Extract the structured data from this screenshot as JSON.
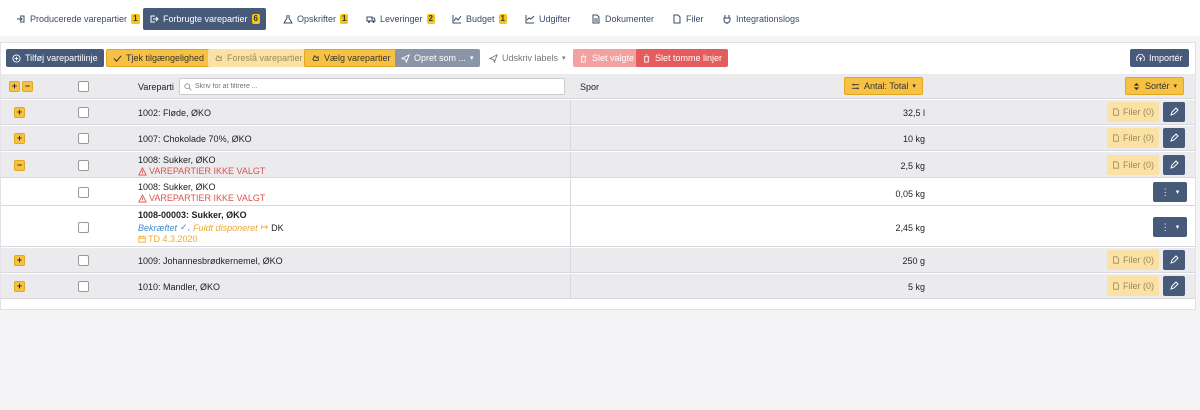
{
  "tabs": [
    {
      "label": "Producerede varepartier",
      "badge": "1"
    },
    {
      "label": "Forbrugte varepartier",
      "badge": "6"
    },
    {
      "label": "Opskrifter",
      "badge": "1"
    },
    {
      "label": "Leveringer",
      "badge": "2"
    },
    {
      "label": "Budget",
      "badge": "1"
    },
    {
      "label": "Udgifter",
      "badge": ""
    },
    {
      "label": "Dokumenter",
      "badge": ""
    },
    {
      "label": "Filer",
      "badge": ""
    },
    {
      "label": "Integrationslogs",
      "badge": ""
    }
  ],
  "toolbar": {
    "add_line": "Tilføj varepartilinje",
    "check_availability": "Tjek tilgængelighed",
    "suggest": "Foreslå varepartier",
    "choose": "Vælg varepartier",
    "create_as": "Opret som ...",
    "print_labels": "Udskriv labels",
    "delete_selected": "Slet valgte",
    "delete_empty": "Slet tomme linjer",
    "import": "Importér"
  },
  "table": {
    "col_batch": "Vareparti",
    "search_placeholder": "Skriv for at filtrere ...",
    "col_trace": "Spor",
    "qty_button": "Antal: Total",
    "sort_button": "Sortér",
    "files_label": "Filer (0)",
    "rows": [
      {
        "name": "1002: Fløde, ØKO",
        "qty": "32,5 l"
      },
      {
        "name": "1007: Chokolade 70%, ØKO",
        "qty": "10 kg"
      },
      {
        "name": "1008: Sukker, ØKO",
        "warning": "VAREPARTIER IKKE VALGT",
        "qty": "2,5 kg"
      },
      {
        "name": "1008: Sukker, ØKO",
        "warning": "VAREPARTIER IKKE VALGT",
        "qty": "0,05 kg"
      },
      {
        "name": "1008-00003: Sukker, ØKO",
        "status_confirmed": "Bekræftet",
        "status_disposed": "Fuldt disponeret",
        "country": "DK",
        "date": "TD 4.3.2020",
        "qty": "2,45 kg"
      },
      {
        "name": "1009: Johannesbrødkernemel, ØKO",
        "qty": "250 g"
      },
      {
        "name": "1010: Mandler, ØKO",
        "qty": "5 kg"
      }
    ]
  },
  "colors": {
    "primary": "#475a7a",
    "accent": "#f7c243",
    "danger": "#e55c5c"
  }
}
